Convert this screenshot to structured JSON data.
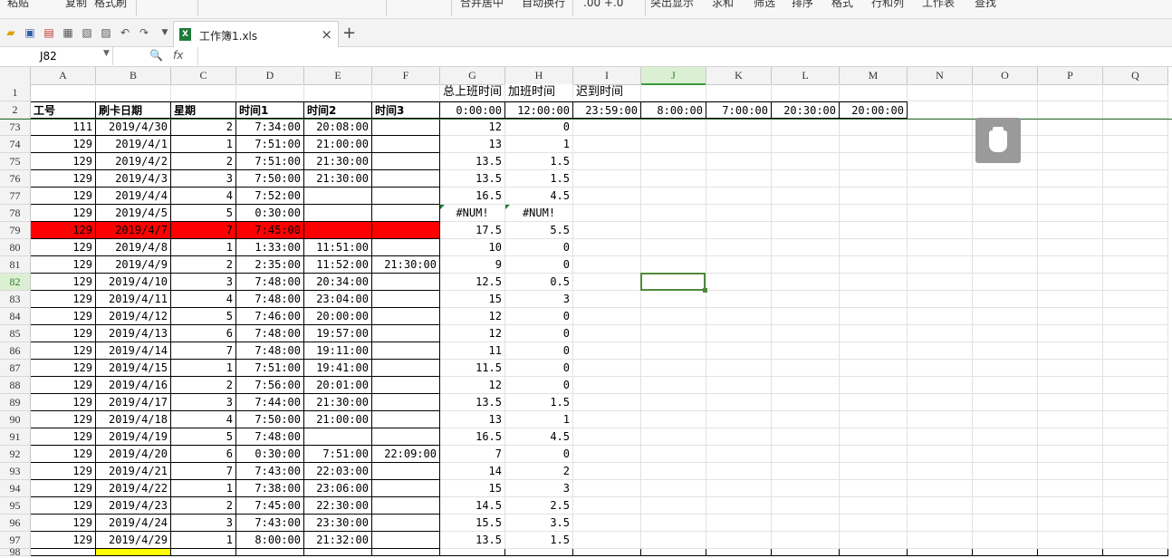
{
  "ribbon": {
    "items": [
      "粘贴",
      "复制",
      "格式刷",
      "合并居中",
      "自动换行",
      ".00  +.0",
      "突出显示",
      "求和",
      "筛选",
      "排序",
      "格式",
      "行和列",
      "工作表",
      "查找"
    ]
  },
  "toolbar": {
    "file_tab": "工作簿1.xls",
    "close": "×",
    "new_tab": "+"
  },
  "formula_bar": {
    "name_box": "J82",
    "fx": "fx",
    "formula": ""
  },
  "columns": [
    "A",
    "B",
    "C",
    "D",
    "E",
    "F",
    "G",
    "H",
    "I",
    "J",
    "K",
    "L",
    "M",
    "N",
    "O",
    "P",
    "Q"
  ],
  "row1": {
    "num": "1",
    "G": "总上班时间",
    "H": "加班时间",
    "I": "迟到时间"
  },
  "row2": {
    "num": "2",
    "A": "工号",
    "B": "刷卡日期",
    "C": "星期",
    "D": "时间1",
    "E": "时间2",
    "F": "时间3",
    "G": "0:00:00",
    "H": "12:00:00",
    "I": "23:59:00",
    "J": "8:00:00",
    "K": "7:00:00",
    "L": "20:30:00",
    "M": "20:00:00"
  },
  "rows": [
    {
      "num": "73",
      "A": "111",
      "B": "2019/4/30",
      "C": "2",
      "D": "7:34:00",
      "E": "20:08:00",
      "F": "",
      "G": "12",
      "H": "0"
    },
    {
      "num": "74",
      "A": "129",
      "B": "2019/4/1",
      "C": "1",
      "D": "7:51:00",
      "E": "21:00:00",
      "F": "",
      "G": "13",
      "H": "1"
    },
    {
      "num": "75",
      "A": "129",
      "B": "2019/4/2",
      "C": "2",
      "D": "7:51:00",
      "E": "21:30:00",
      "F": "",
      "G": "13.5",
      "H": "1.5"
    },
    {
      "num": "76",
      "A": "129",
      "B": "2019/4/3",
      "C": "3",
      "D": "7:50:00",
      "E": "21:30:00",
      "F": "",
      "G": "13.5",
      "H": "1.5"
    },
    {
      "num": "77",
      "A": "129",
      "B": "2019/4/4",
      "C": "4",
      "D": "7:52:00",
      "E": "",
      "F": "",
      "G": "16.5",
      "H": "4.5"
    },
    {
      "num": "78",
      "A": "129",
      "B": "2019/4/5",
      "C": "5",
      "D": "0:30:00",
      "E": "",
      "F": "",
      "G": "#NUM!",
      "H": "#NUM!"
    },
    {
      "num": "79",
      "A": "129",
      "B": "2019/4/7",
      "C": "7",
      "D": "7:45:00",
      "E": "",
      "F": "",
      "G": "17.5",
      "H": "5.5",
      "highlight": true
    },
    {
      "num": "80",
      "A": "129",
      "B": "2019/4/8",
      "C": "1",
      "D": "1:33:00",
      "E": "11:51:00",
      "F": "",
      "G": "10",
      "H": "0"
    },
    {
      "num": "81",
      "A": "129",
      "B": "2019/4/9",
      "C": "2",
      "D": "2:35:00",
      "E": "11:52:00",
      "F": "21:30:00",
      "G": "9",
      "H": "0"
    },
    {
      "num": "82",
      "A": "129",
      "B": "2019/4/10",
      "C": "3",
      "D": "7:48:00",
      "E": "20:34:00",
      "F": "",
      "G": "12.5",
      "H": "0.5"
    },
    {
      "num": "83",
      "A": "129",
      "B": "2019/4/11",
      "C": "4",
      "D": "7:48:00",
      "E": "23:04:00",
      "F": "",
      "G": "15",
      "H": "3"
    },
    {
      "num": "84",
      "A": "129",
      "B": "2019/4/12",
      "C": "5",
      "D": "7:46:00",
      "E": "20:00:00",
      "F": "",
      "G": "12",
      "H": "0"
    },
    {
      "num": "85",
      "A": "129",
      "B": "2019/4/13",
      "C": "6",
      "D": "7:48:00",
      "E": "19:57:00",
      "F": "",
      "G": "12",
      "H": "0"
    },
    {
      "num": "86",
      "A": "129",
      "B": "2019/4/14",
      "C": "7",
      "D": "7:48:00",
      "E": "19:11:00",
      "F": "",
      "G": "11",
      "H": "0"
    },
    {
      "num": "87",
      "A": "129",
      "B": "2019/4/15",
      "C": "1",
      "D": "7:51:00",
      "E": "19:41:00",
      "F": "",
      "G": "11.5",
      "H": "0"
    },
    {
      "num": "88",
      "A": "129",
      "B": "2019/4/16",
      "C": "2",
      "D": "7:56:00",
      "E": "20:01:00",
      "F": "",
      "G": "12",
      "H": "0"
    },
    {
      "num": "89",
      "A": "129",
      "B": "2019/4/17",
      "C": "3",
      "D": "7:44:00",
      "E": "21:30:00",
      "F": "",
      "G": "13.5",
      "H": "1.5"
    },
    {
      "num": "90",
      "A": "129",
      "B": "2019/4/18",
      "C": "4",
      "D": "7:50:00",
      "E": "21:00:00",
      "F": "",
      "G": "13",
      "H": "1"
    },
    {
      "num": "91",
      "A": "129",
      "B": "2019/4/19",
      "C": "5",
      "D": "7:48:00",
      "E": "",
      "F": "",
      "G": "16.5",
      "H": "4.5"
    },
    {
      "num": "92",
      "A": "129",
      "B": "2019/4/20",
      "C": "6",
      "D": "0:30:00",
      "E": "7:51:00",
      "F": "22:09:00",
      "G": "7",
      "H": "0"
    },
    {
      "num": "93",
      "A": "129",
      "B": "2019/4/21",
      "C": "7",
      "D": "7:43:00",
      "E": "22:03:00",
      "F": "",
      "G": "14",
      "H": "2"
    },
    {
      "num": "94",
      "A": "129",
      "B": "2019/4/22",
      "C": "1",
      "D": "7:38:00",
      "E": "23:06:00",
      "F": "",
      "G": "15",
      "H": "3"
    },
    {
      "num": "95",
      "A": "129",
      "B": "2019/4/23",
      "C": "2",
      "D": "7:45:00",
      "E": "22:30:00",
      "F": "",
      "G": "14.5",
      "H": "2.5"
    },
    {
      "num": "96",
      "A": "129",
      "B": "2019/4/24",
      "C": "3",
      "D": "7:43:00",
      "E": "23:30:00",
      "F": "",
      "G": "15.5",
      "H": "3.5"
    },
    {
      "num": "97",
      "A": "129",
      "B": "2019/4/29",
      "C": "1",
      "D": "8:00:00",
      "E": "21:32:00",
      "F": "",
      "G": "13.5",
      "H": "1.5"
    }
  ],
  "colors": {
    "highlight": "#ff0000",
    "selection": "#4f8a3a",
    "excel_green": "#1e7b3a"
  }
}
